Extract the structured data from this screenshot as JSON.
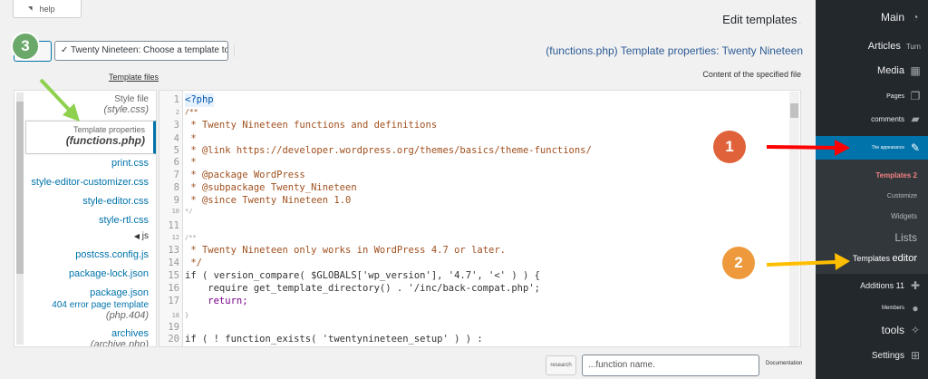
{
  "help_tab": {
    "label": "help"
  },
  "header": {
    "title": "Edit templates",
    "theme_select_value": "✓ Twenty Nineteen: Choose a template to edit",
    "file_heading": "(functions.php) Template properties: Twenty Nineteen",
    "template_files_label": "Template files",
    "content_label": "Content of the specified file"
  },
  "files": [
    {
      "label": "Style file",
      "filename": "(style.css)"
    },
    {
      "label": "Template properties",
      "filename": "(functions.php)"
    },
    {
      "label": "print.css"
    },
    {
      "label": "style-editor-customizer.css"
    },
    {
      "label": "style-editor.css"
    },
    {
      "label": "style-rtl.css"
    },
    {
      "label": "js"
    },
    {
      "label": "postcss.config.js"
    },
    {
      "label": "package-lock.json"
    },
    {
      "label": "package.json"
    },
    {
      "label": "404 error page template",
      "filename": "(php.404)"
    },
    {
      "label": "archives",
      "filename": "(archive.php)"
    }
  ],
  "code_lines": [
    {
      "n": "1",
      "text": "<?php"
    },
    {
      "n": "2",
      "text": "/**"
    },
    {
      "n": "3",
      "text": " * Twenty Nineteen functions and definitions"
    },
    {
      "n": "4",
      "text": " *"
    },
    {
      "n": "5",
      "text": " * @link https://developer.wordpress.org/themes/basics/theme-functions/"
    },
    {
      "n": "6",
      "text": " *"
    },
    {
      "n": "7",
      "text": " * @package WordPress"
    },
    {
      "n": "8",
      "text": " * @subpackage Twenty_Nineteen"
    },
    {
      "n": "9",
      "text": " * @since Twenty Nineteen 1.0"
    },
    {
      "n": "10",
      "text": "*/"
    },
    {
      "n": "11",
      "text": ""
    },
    {
      "n": "12",
      "text": "/**"
    },
    {
      "n": "13",
      "text": " * Twenty Nineteen only works in WordPress 4.7 or later."
    },
    {
      "n": "14",
      "text": " */"
    },
    {
      "n": "15",
      "text": "if ( version_compare( $GLOBALS['wp_version'], '4.7', '<' ) ) {"
    },
    {
      "n": "16",
      "text": "    require get_template_directory() . '/inc/back-compat.php';"
    },
    {
      "n": "17",
      "text": "    return;"
    },
    {
      "n": "18",
      "text": "}"
    },
    {
      "n": "19",
      "text": ""
    },
    {
      "n": "20",
      "text": "if ( ! function_exists( 'twentynineteen_setup' ) ) :"
    }
  ],
  "bottom": {
    "research_button": "research",
    "function_placeholder": "...function name.",
    "documentation_label": "Documentation"
  },
  "admin_menu": {
    "main": "Main",
    "articles": "Articles",
    "articles_extra": "Turn",
    "media": "Media",
    "pages": "Pages",
    "comments": "comments",
    "appearance": "The appearance",
    "templates": "Templates 2",
    "customize": "Customize",
    "widgets": "Widgets",
    "lists": "Lists",
    "templates_editor_a": "Templates",
    "templates_editor_b": "editor",
    "additions": "Additions 11",
    "members": "Members",
    "tools": "tools",
    "settings": "Settings"
  },
  "annotations": {
    "badge_1": "1",
    "badge_2": "2",
    "badge_3": "3"
  },
  "colors": {
    "admin_bg": "#23282d",
    "accent_blue": "#0073aa",
    "badge_orange": "#e0623a",
    "badge_amber": "#ee9a3c",
    "badge_green": "#6aa96a",
    "arrow_red": "#ff0000",
    "arrow_yellow": "#ffbf00",
    "arrow_green": "#8ed14e"
  }
}
